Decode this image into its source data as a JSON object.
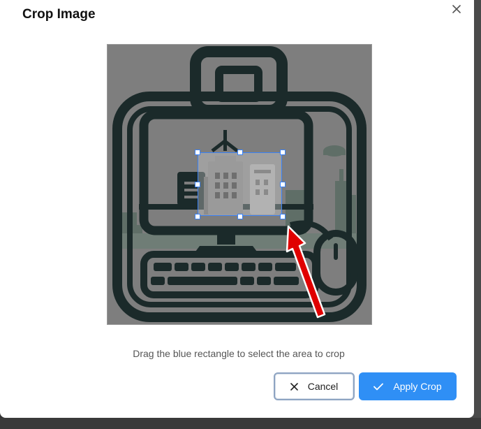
{
  "dialog": {
    "title": "Crop Image",
    "close_label": "×"
  },
  "instructions": "Drag the blue rectangle to select the area to crop",
  "buttons": {
    "cancel_label": "Cancel",
    "apply_label": "Apply Crop"
  },
  "colors": {
    "accent": "#3b82f6",
    "primary_button": "#2f8ff5",
    "overlay": "#7e7e7e",
    "annotation_arrow": "#e00000"
  },
  "icons": {
    "close": "close-icon",
    "cancel": "x-icon",
    "apply": "check-icon"
  }
}
